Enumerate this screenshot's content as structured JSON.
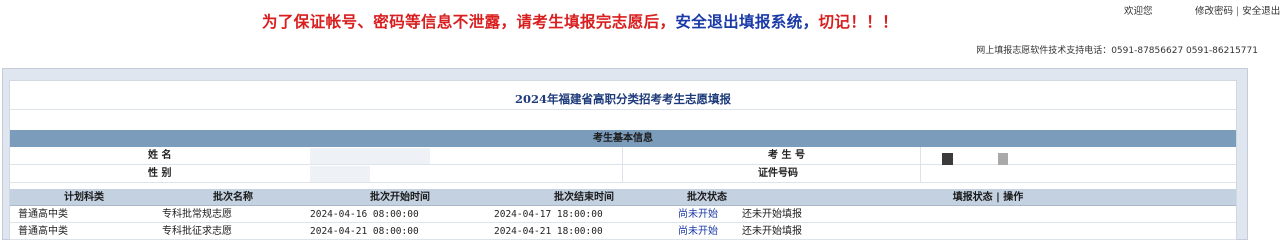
{
  "header": {
    "warning_red": "为了保证帐号、密码等信息不泄露，请考生填报完志愿后，",
    "warning_blue": "安全退出填报系统，",
    "warning_end": "切记！！！",
    "welcome": "欢迎您",
    "change_password": "修改密码",
    "separator": "|",
    "logout": "安全退出",
    "support_line": "网上填报志愿软件技术支持电话：0591-87856627 0591-86215771"
  },
  "page": {
    "title": "2024年福建省高职分类招考考生志愿填报"
  },
  "basic_info": {
    "section_title": "考生基本信息",
    "name_label": "姓   名",
    "gender_label": "性   别",
    "exam_no_label": "考 生 号",
    "id_no_label": "证件号码"
  },
  "batch_table": {
    "headers": [
      "计划科类",
      "批次名称",
      "批次开始时间",
      "批次结束时间",
      "批次状态",
      "填报状态 | 操作"
    ],
    "rows": [
      [
        "普通高中类",
        "专科批常规志愿",
        "2024-04-16 08:00:00",
        "2024-04-17 18:00:00",
        "尚未开始",
        "还未开始填报"
      ],
      [
        "普通高中类",
        "专科批征求志愿",
        "2024-04-21 08:00:00",
        "2024-04-21 18:00:00",
        "尚未开始",
        "还未开始填报"
      ]
    ]
  },
  "colors": {
    "warning_red": "#d81e1e",
    "warning_blue": "#1a3aa8",
    "section_header_bg": "#7b9cbb",
    "column_header_bg": "#c3d1e0",
    "frame_bg": "#dfe6ef"
  }
}
